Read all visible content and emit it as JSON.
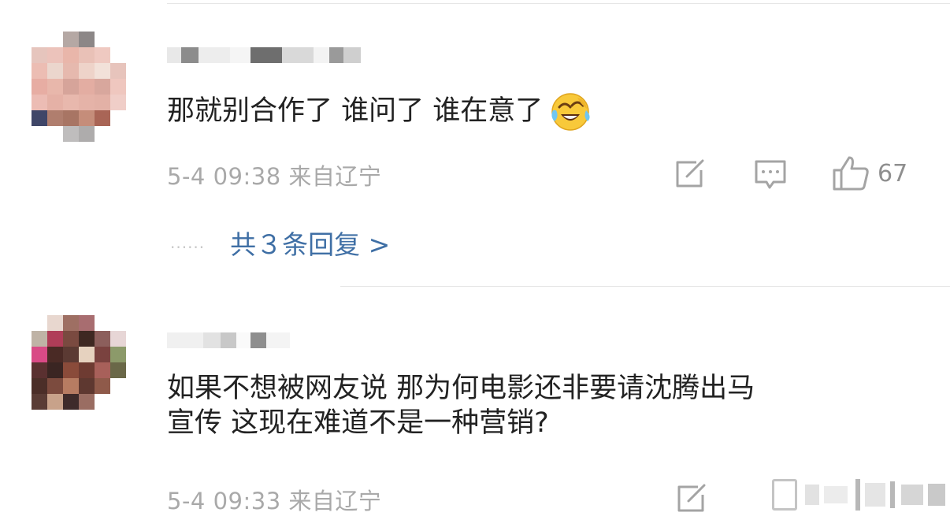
{
  "comments": [
    {
      "text": "那就别合作了 谁问了 谁在意了",
      "emoji": "laughing-crying-emoji",
      "meta": "5-4 09:38 来自辽宁",
      "likes": "67",
      "replies_text": "共３条回复 >",
      "replies_dots": "......"
    },
    {
      "text_line1": "如果不想被网友说 那为何电影还非要请沈腾出马",
      "text_line2": "宣传 这现在难道不是一种营销?",
      "meta": "5-4 09:33 来自辽宁"
    }
  ],
  "icons": {
    "share": "share-icon",
    "comment": "comment-icon",
    "like": "thumbs-up-icon"
  },
  "colors": {
    "text": "#222222",
    "meta": "#a9a9a9",
    "link": "#3f6fa5",
    "icon": "#a4a4a4",
    "divider": "#e6e6e6"
  }
}
